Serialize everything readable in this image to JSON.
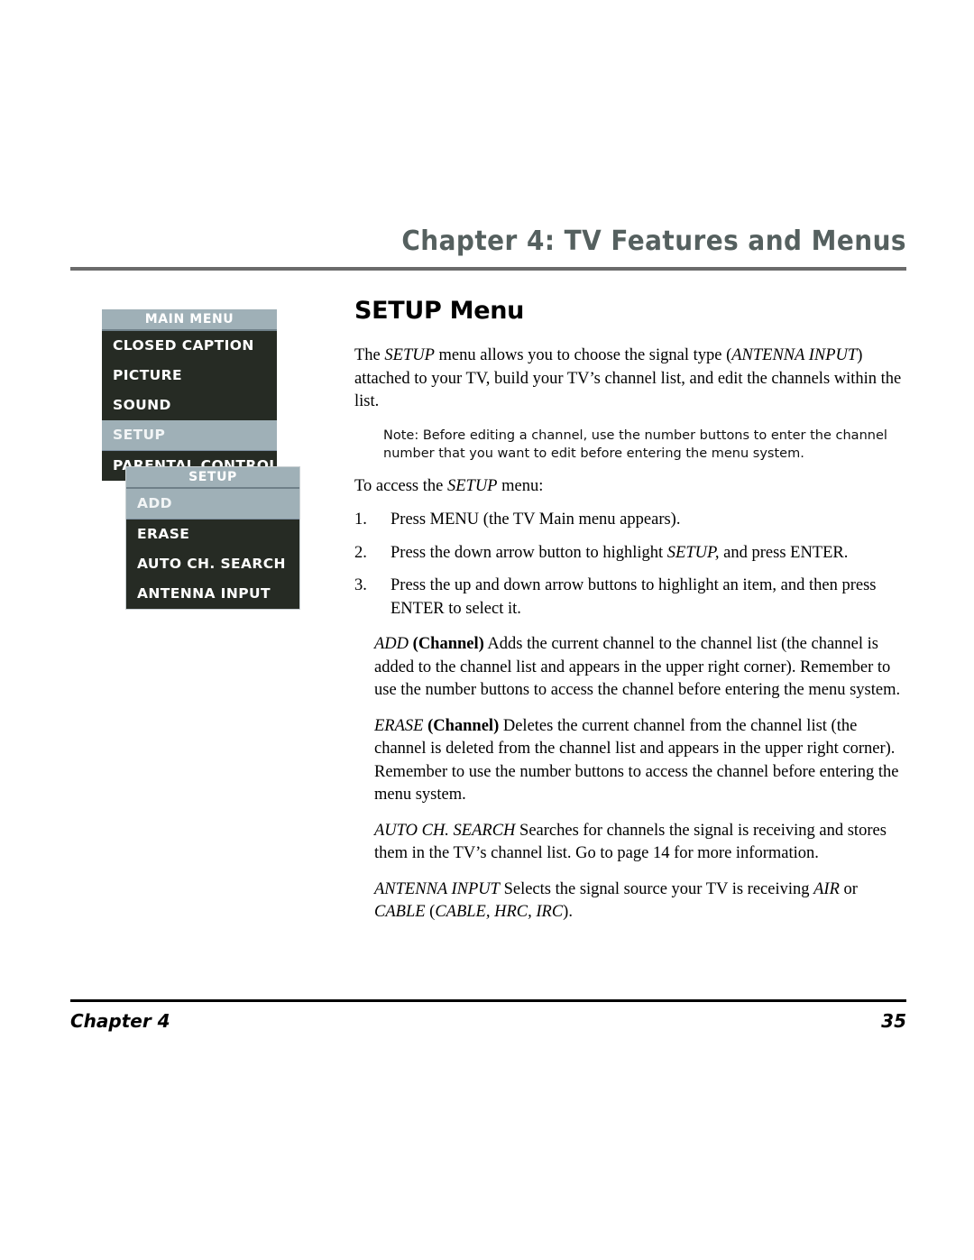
{
  "header": {
    "chapter_title": "Chapter 4: TV Features and Menus",
    "rule_color": "#6b6b6b",
    "title_color": "#55605f"
  },
  "osd": {
    "main_menu": {
      "title": "MAIN MENU",
      "items": [
        {
          "label": "CLOSED CAPTION",
          "selected": false
        },
        {
          "label": "PICTURE",
          "selected": false
        },
        {
          "label": "SOUND",
          "selected": false
        },
        {
          "label": "SETUP",
          "selected": true
        },
        {
          "label": "PARENTAL CONTROL",
          "selected": false
        }
      ]
    },
    "setup_menu": {
      "title": "SETUP",
      "items": [
        {
          "label": "ADD",
          "selected": true
        },
        {
          "label": "ERASE",
          "selected": false
        },
        {
          "label": "AUTO CH. SEARCH",
          "selected": false
        },
        {
          "label": "ANTENNA INPUT",
          "selected": false
        }
      ]
    },
    "colors": {
      "panel_background": "#262b24",
      "highlight": "#9fb0b7",
      "text": "#ffffff"
    }
  },
  "main": {
    "heading": "SETUP Menu",
    "intro": {
      "pre": "The ",
      "em1": "SETUP",
      "mid": " menu allows you to choose the signal type (",
      "em2": "ANTENNA INPUT",
      "post": ") attached to your TV, build your TV’s channel list, and edit the channels within the list."
    },
    "note": "Note:  Before editing a channel, use the number buttons to enter the channel number that you want to edit before entering the menu system.",
    "access_line": {
      "pre": "To access the ",
      "em": "SETUP",
      "post": " menu:"
    },
    "steps": [
      {
        "num": "1.",
        "pre": "Press MENU (the TV Main menu appears).",
        "em": "",
        "post": ""
      },
      {
        "num": "2.",
        "pre": "Press the down arrow button to highlight ",
        "em": "SETUP,",
        "post": " and press ENTER."
      },
      {
        "num": "3.",
        "pre": "Press the up and down arrow buttons to highlight an item, and then press ENTER to select it.",
        "em": "",
        "post": ""
      }
    ],
    "definitions": [
      {
        "term": "ADD",
        "qualifier": "(Channel)",
        "text": "  Adds the current channel to the channel list (the channel is added to the channel list and appears in the upper right corner). Remember to use the number buttons to access the channel before entering the menu system."
      },
      {
        "term": "ERASE",
        "qualifier": "(Channel)",
        "text": "  Deletes the current channel from the channel list (the channel is deleted from the channel list and appears in the upper right corner).  Remember to use the number buttons to access the channel before entering the menu system."
      },
      {
        "term": "AUTO  CH. SEARCH",
        "qualifier": "",
        "text": "  Searches for channels the signal is receiving and stores them in the TV’s channel list. Go to page 14 for more information."
      }
    ],
    "antenna_def": {
      "term": "ANTENNA INPUT",
      "pre": " Selects the signal source your TV is receiving ",
      "em1": "AIR",
      "mid": " or ",
      "em2": "CABLE",
      "post_open": "(",
      "em3": "CABLE, HRC, IRC",
      "post_close": ")."
    }
  },
  "footer": {
    "chapter_label": "Chapter 4",
    "page_number": "35"
  }
}
